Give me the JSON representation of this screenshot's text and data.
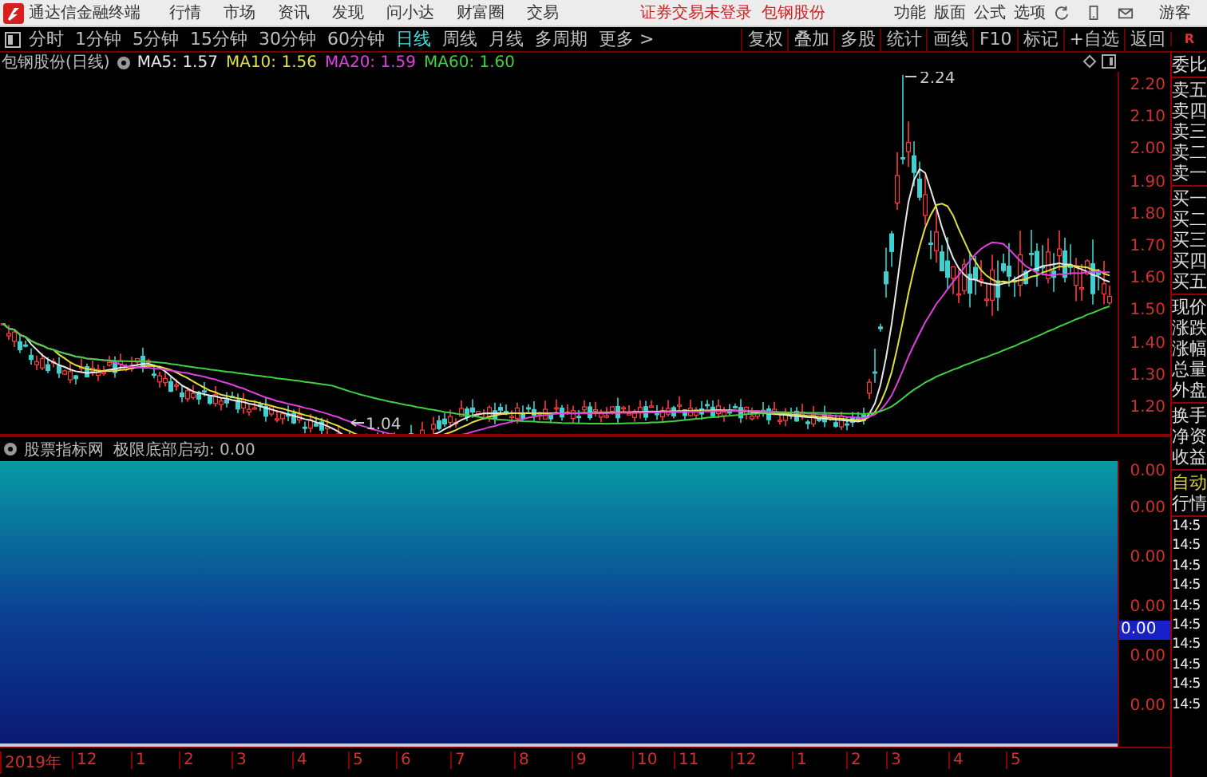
{
  "menu_bar": {
    "app_title": "通达信金融终端",
    "menus": [
      "行情",
      "市场",
      "资讯",
      "发现",
      "问小达",
      "财富圈",
      "交易"
    ],
    "login_status": "证券交易未登录",
    "stock_name": "包钢股份",
    "tools": [
      "功能",
      "版面",
      "公式",
      "选项"
    ],
    "user": "游客"
  },
  "period_tabs": [
    {
      "label": "分时",
      "selected": false
    },
    {
      "label": "1分钟",
      "selected": false
    },
    {
      "label": "5分钟",
      "selected": false
    },
    {
      "label": "15分钟",
      "selected": false
    },
    {
      "label": "30分钟",
      "selected": false
    },
    {
      "label": "60分钟",
      "selected": false
    },
    {
      "label": "日线",
      "selected": true
    },
    {
      "label": "周线",
      "selected": false
    },
    {
      "label": "月线",
      "selected": false
    },
    {
      "label": "多周期",
      "selected": false
    },
    {
      "label": "更多 >",
      "selected": false
    }
  ],
  "chart_tools": [
    "复权",
    "叠加",
    "多股",
    "统计",
    "画线",
    "F10",
    "标记",
    "+自选",
    "返回"
  ],
  "corner_label": "R",
  "legend": {
    "title": "包钢股份(日线)",
    "averages": [
      {
        "label": "MA5: 1.57",
        "color": "#e8e8e8"
      },
      {
        "label": "MA10: 1.56",
        "color": "#e0e040"
      },
      {
        "label": "MA20: 1.59",
        "color": "#e040e0"
      },
      {
        "label": "MA60: 1.60",
        "color": "#40d040"
      }
    ]
  },
  "price_axis": [
    "2.20",
    "2.10",
    "2.00",
    "1.90",
    "1.80",
    "1.70",
    "1.60",
    "1.50",
    "1.40",
    "1.30",
    "1.20"
  ],
  "annotations": {
    "high": "2.24",
    "low": "1.04"
  },
  "quote_panel": {
    "groups": [
      [
        "委比"
      ],
      [
        "卖五",
        "卖四",
        "卖三",
        "卖二",
        "卖一"
      ],
      [
        "买一",
        "买二",
        "买三",
        "买四",
        "买五"
      ],
      [
        "现价",
        "涨跌",
        "涨幅",
        "总量",
        "外盘"
      ],
      [
        "换手",
        "净资",
        "收益"
      ]
    ],
    "mode": "自动",
    "view": "行情",
    "ticks": [
      "14:5",
      "14:5",
      "14:5",
      "14:5",
      "14:5",
      "14:5",
      "14:5",
      "14:5",
      "14:5",
      "14:5"
    ]
  },
  "indicator": {
    "source": "股票指标网",
    "name": "极限底部启动: 0.00",
    "axis_labels": [
      "0.00",
      "0.00",
      "0.00",
      "0.00",
      "0.00",
      "0.00"
    ],
    "cursor_value": "0.00"
  },
  "date_axis": [
    "2019年",
    "12",
    "1",
    "2",
    "3",
    "4",
    "5",
    "6",
    "7",
    "8",
    "9",
    "10",
    "11",
    "12",
    "1",
    "2",
    "3",
    "4",
    "5"
  ]
}
